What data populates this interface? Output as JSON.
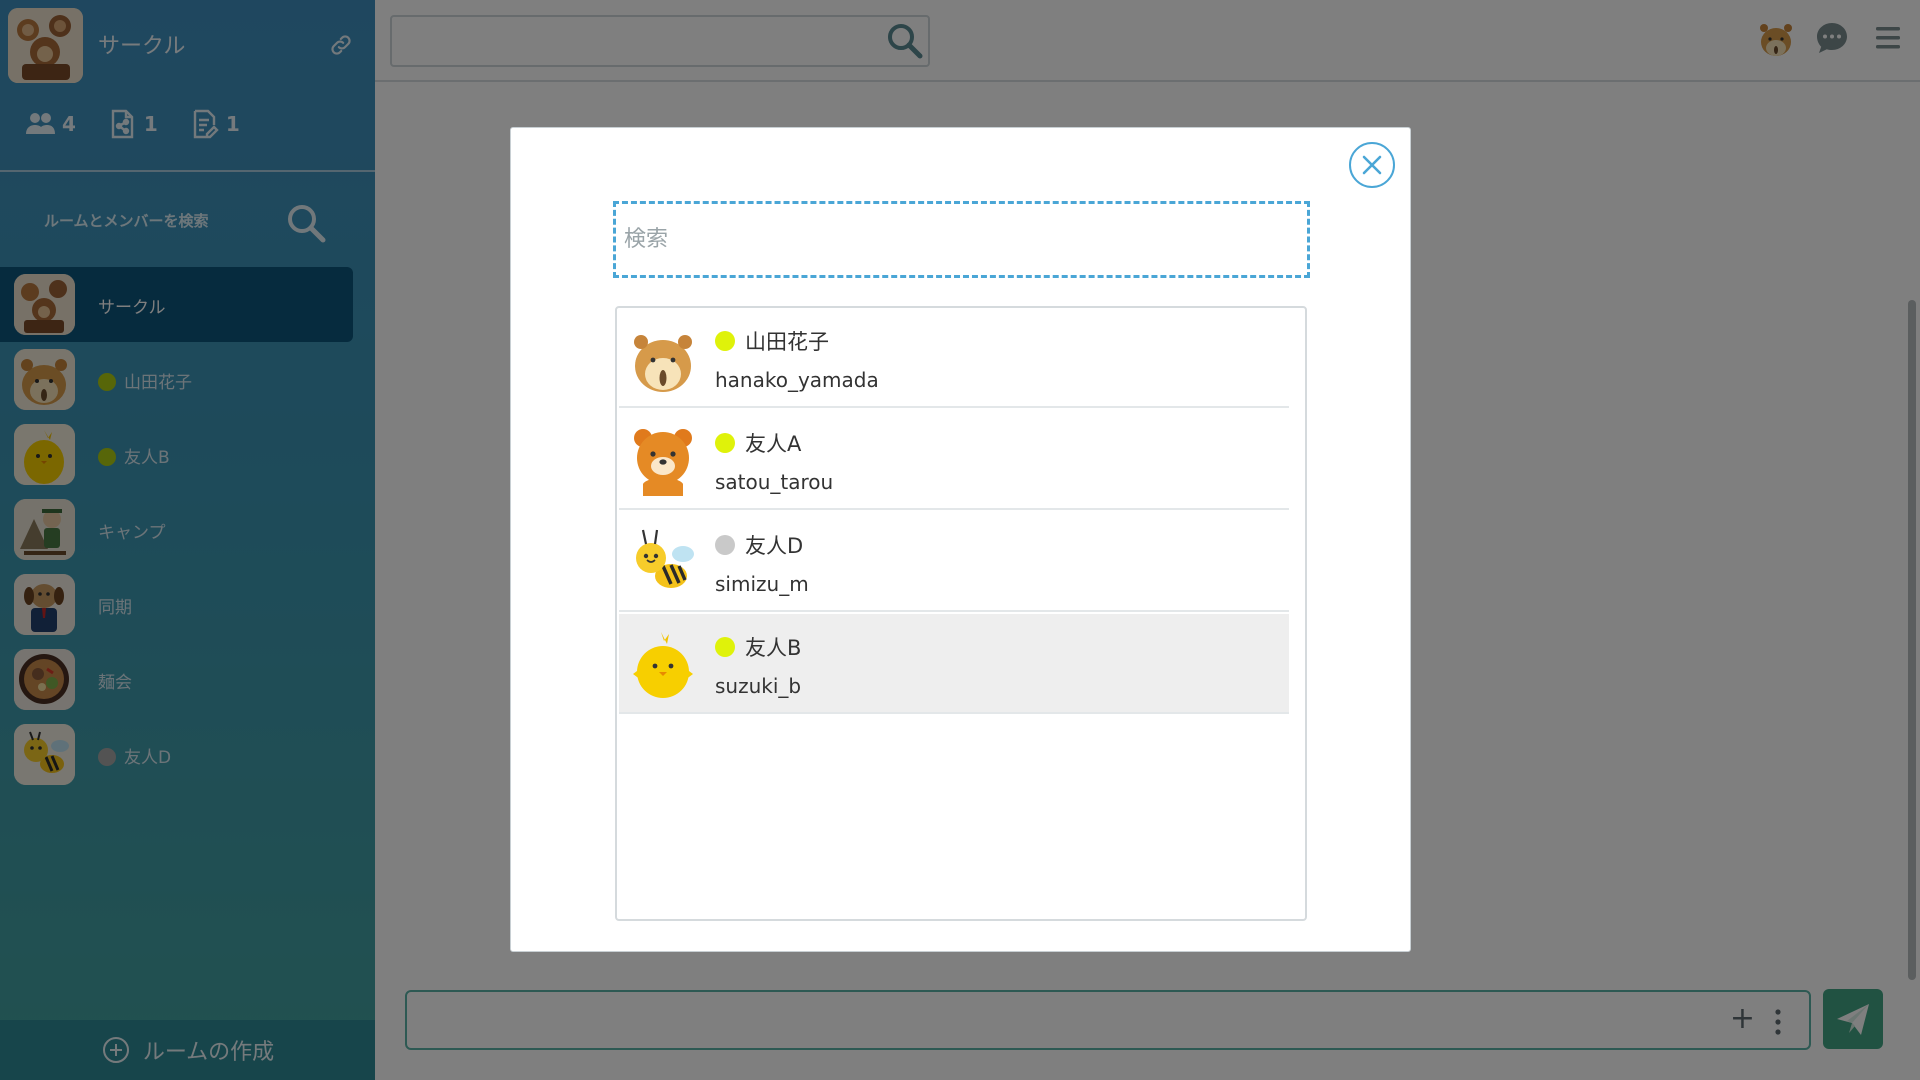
{
  "colors": {
    "online": "#dff20a",
    "offline": "#c9c9c9",
    "accent": "#4aa6d6",
    "active_room": "#0d567c",
    "send": "#43a584"
  },
  "sidebar": {
    "title": "サークル",
    "stats": [
      {
        "icon": "people-icon",
        "count": "4"
      },
      {
        "icon": "file-share-icon",
        "count": "1"
      },
      {
        "icon": "note-icon",
        "count": "1"
      }
    ],
    "search_label": "ルームとメンバーを検索",
    "rooms": [
      {
        "name": "サークル",
        "status": "",
        "avatar": "group-avatar"
      },
      {
        "name": "山田花子",
        "status": "online",
        "avatar": "hamster-avatar"
      },
      {
        "name": "友人B",
        "status": "online",
        "avatar": "chick-avatar"
      },
      {
        "name": "キャンプ",
        "status": "",
        "avatar": "camp-avatar"
      },
      {
        "name": "同期",
        "status": "",
        "avatar": "dog-avatar"
      },
      {
        "name": "麺会",
        "status": "",
        "avatar": "ramen-avatar"
      },
      {
        "name": "友人D",
        "status": "offline",
        "avatar": "bee-avatar"
      }
    ],
    "create_room_label": "ルームの作成"
  },
  "modal": {
    "search_placeholder": "検索",
    "members": [
      {
        "name": "山田花子",
        "id": "hanako_yamada",
        "status": "online",
        "avatar": "hamster-avatar"
      },
      {
        "name": "友人A",
        "id": "satou_tarou",
        "status": "online",
        "avatar": "bear-avatar"
      },
      {
        "name": "友人D",
        "id": "simizu_m",
        "status": "offline",
        "avatar": "bee-avatar"
      },
      {
        "name": "友人B",
        "id": "suzuki_b",
        "status": "online",
        "avatar": "chick-avatar"
      }
    ]
  }
}
